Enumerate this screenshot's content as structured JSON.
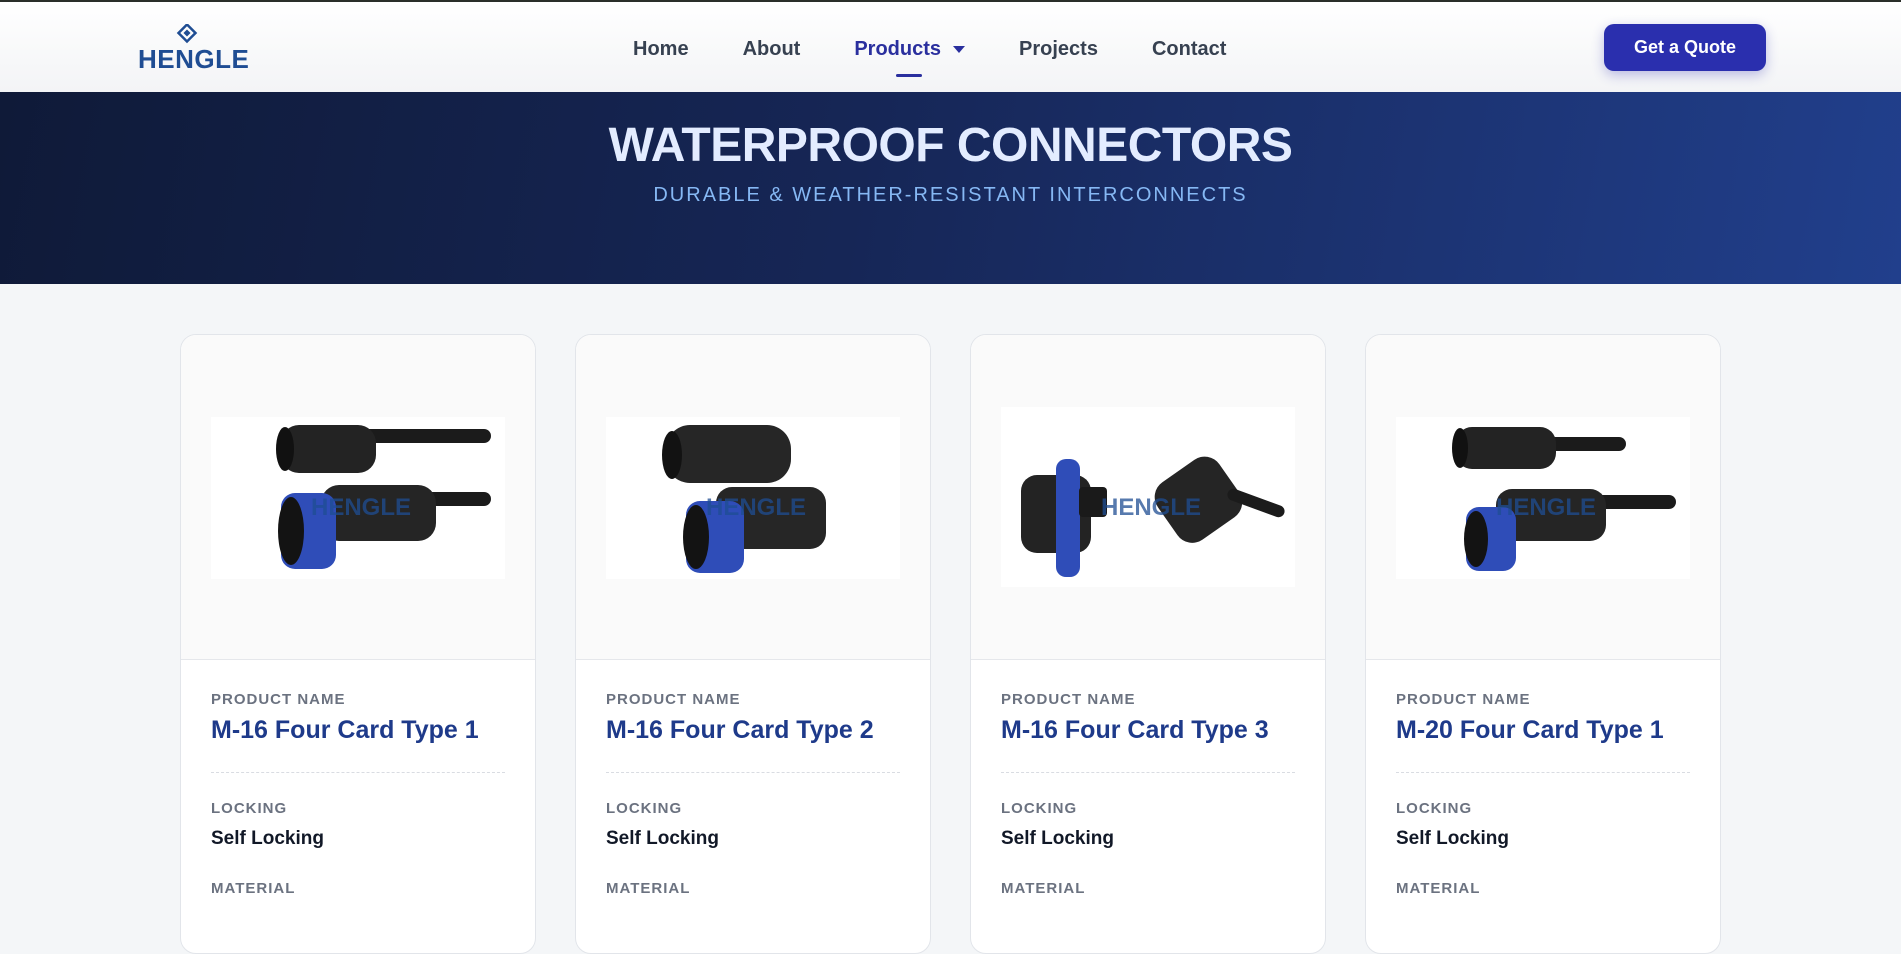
{
  "header": {
    "logo_text": "HENGLE",
    "nav": [
      {
        "label": "Home"
      },
      {
        "label": "About"
      },
      {
        "label": "Products"
      },
      {
        "label": "Projects"
      },
      {
        "label": "Contact"
      }
    ],
    "active_nav": "Products",
    "quote_button": "Get a Quote"
  },
  "hero": {
    "title": "WATERPROOF CONNECTORS",
    "subtitle": "DURABLE & WEATHER-RESISTANT INTERCONNECTS"
  },
  "labels": {
    "product_name": "PRODUCT NAME",
    "locking": "LOCKING",
    "material": "MATERIAL"
  },
  "products": [
    {
      "name": "M-16 Four Card Type 1",
      "locking": "Self Locking",
      "image_watermark": "HENGLE"
    },
    {
      "name": "M-16 Four Card Type 2",
      "locking": "Self Locking",
      "image_watermark": "HENGLE"
    },
    {
      "name": "M-16 Four Card Type 3",
      "locking": "Self Locking",
      "image_watermark": "HENGLE"
    },
    {
      "name": "M-20 Four Card Type 1",
      "locking": "Self Locking",
      "image_watermark": "HENGLE"
    }
  ],
  "colors": {
    "accent": "#2a2fae",
    "product_title": "#1e3a8a",
    "hero_start": "#0f1a38",
    "hero_end": "#213f8c",
    "connector_blue": "#2f4db8"
  }
}
